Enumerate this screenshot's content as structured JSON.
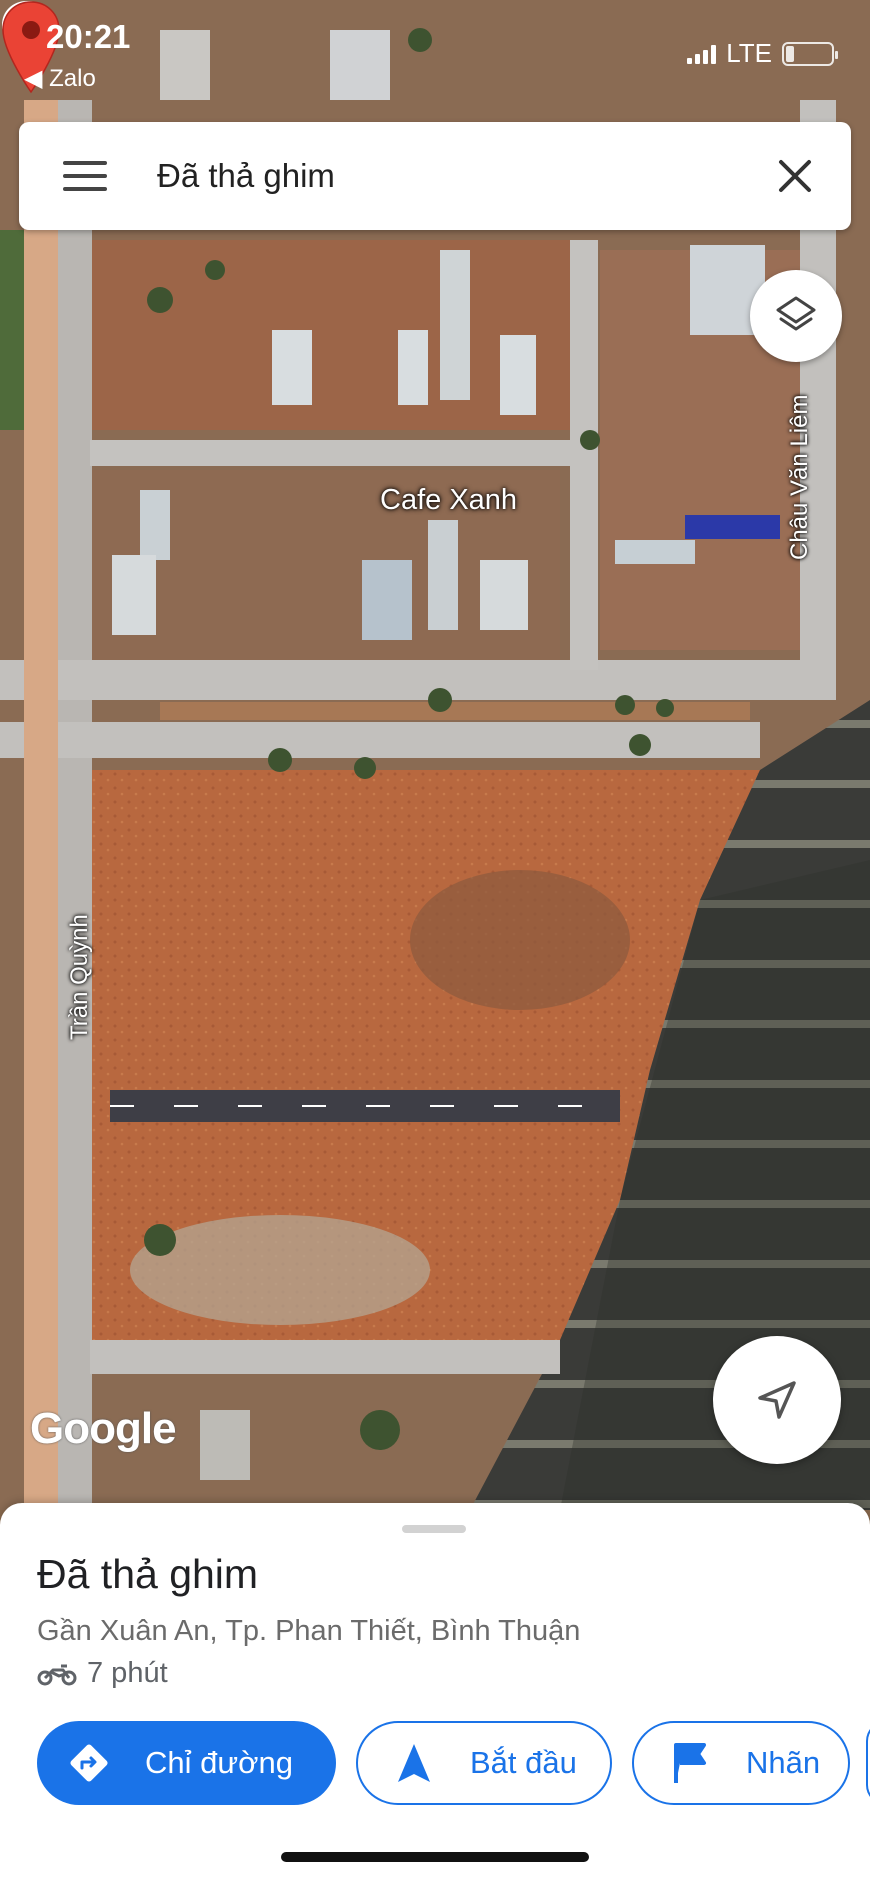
{
  "status_bar": {
    "time": "20:21",
    "back_app": "◀ Zalo",
    "network": "LTE"
  },
  "search_bar": {
    "query": "Đã thả ghim"
  },
  "map": {
    "poi_name": "Cafe Xanh",
    "street_right": "Châu Văn Liêm",
    "street_left": "Trần Quỳnh",
    "logo": "Google"
  },
  "place": {
    "title": "Đã thả ghim",
    "address": "Gần Xuân An, Tp. Phan Thiết, Bình Thuận",
    "travel_time": "7 phút",
    "travel_mode_icon": "motorbike-icon"
  },
  "actions": {
    "directions": "Chỉ đường",
    "start": "Bắt đầu",
    "label": "Nhãn"
  },
  "colors": {
    "accent": "#1a73e8",
    "pin": "#ea4335",
    "poi": "#f29a40"
  }
}
